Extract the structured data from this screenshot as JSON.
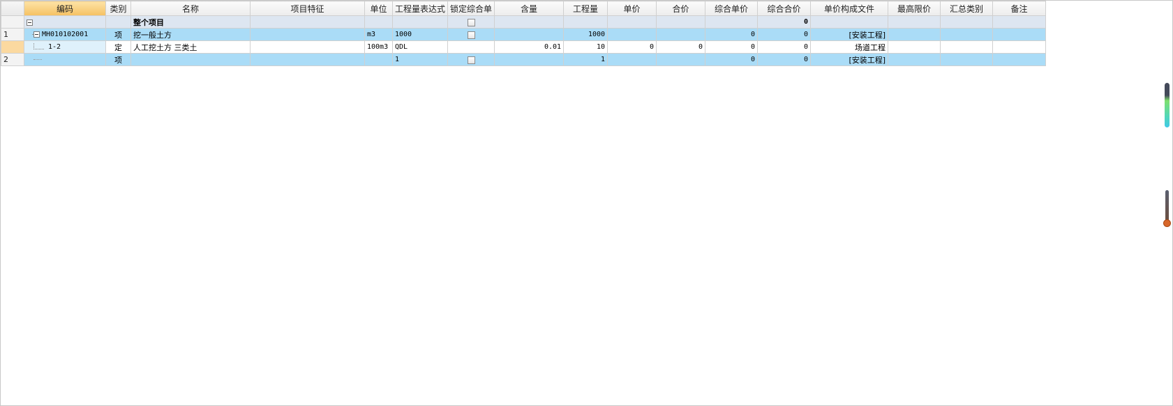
{
  "columns": [
    {
      "key": "code",
      "label": "编码"
    },
    {
      "key": "type",
      "label": "类别"
    },
    {
      "key": "name",
      "label": "名称"
    },
    {
      "key": "feature",
      "label": "项目特征"
    },
    {
      "key": "unit",
      "label": "单位"
    },
    {
      "key": "qty_expr",
      "label": "工程量表达式"
    },
    {
      "key": "lock",
      "label": "锁定综合单"
    },
    {
      "key": "content",
      "label": "含量"
    },
    {
      "key": "qty",
      "label": "工程量"
    },
    {
      "key": "unit_price",
      "label": "单价"
    },
    {
      "key": "total_price",
      "label": "合价"
    },
    {
      "key": "comp_unit_price",
      "label": "综合单价"
    },
    {
      "key": "comp_total",
      "label": "综合合价"
    },
    {
      "key": "price_file",
      "label": "单价构成文件"
    },
    {
      "key": "max_price",
      "label": "最高限价"
    },
    {
      "key": "summary_cat",
      "label": "汇总类别"
    },
    {
      "key": "remark",
      "label": "备注"
    }
  ],
  "rows": [
    {
      "rownum": "",
      "code": "",
      "type": "",
      "name": "整个项目",
      "feature": "",
      "unit": "",
      "qty_expr": "",
      "content": "",
      "qty": "",
      "unit_price": "",
      "total_price": "",
      "comp_unit_price": "",
      "comp_total": "0",
      "price_file": "",
      "max_price": "",
      "summary_cat": "",
      "remark": ""
    },
    {
      "rownum": "1",
      "code": "MH010102001",
      "type": "项",
      "name": "挖一般土方",
      "feature": "",
      "unit": "m3",
      "qty_expr": "1000",
      "content": "",
      "qty": "1000",
      "unit_price": "",
      "total_price": "",
      "comp_unit_price": "0",
      "comp_total": "0",
      "price_file": "[安装工程]",
      "max_price": "",
      "summary_cat": "",
      "remark": ""
    },
    {
      "rownum": "",
      "code": "1-2",
      "type": "定",
      "name": "人工挖土方 三类土",
      "feature": "",
      "unit": "100m3",
      "qty_expr": "QDL",
      "content": "0.01",
      "qty": "10",
      "unit_price": "0",
      "total_price": "0",
      "comp_unit_price": "0",
      "comp_total": "0",
      "price_file": "场道工程",
      "max_price": "",
      "summary_cat": "",
      "remark": ""
    },
    {
      "rownum": "2",
      "code": "",
      "type": "项",
      "name": "",
      "feature": "",
      "unit": "",
      "qty_expr": "1",
      "content": "",
      "qty": "1",
      "unit_price": "",
      "total_price": "",
      "comp_unit_price": "0",
      "comp_total": "0",
      "price_file": "[安装工程]",
      "max_price": "",
      "summary_cat": "",
      "remark": ""
    }
  ],
  "colors": {
    "item_row": "#aadcf7",
    "project_row": "#dde6f1",
    "active_header": "#f5c163",
    "selected_rownum": "#fbd9a0"
  },
  "icons": [
    "collapse-icon",
    "checkbox-icon",
    "level-gauge-icon",
    "temperature-gauge-icon"
  ]
}
